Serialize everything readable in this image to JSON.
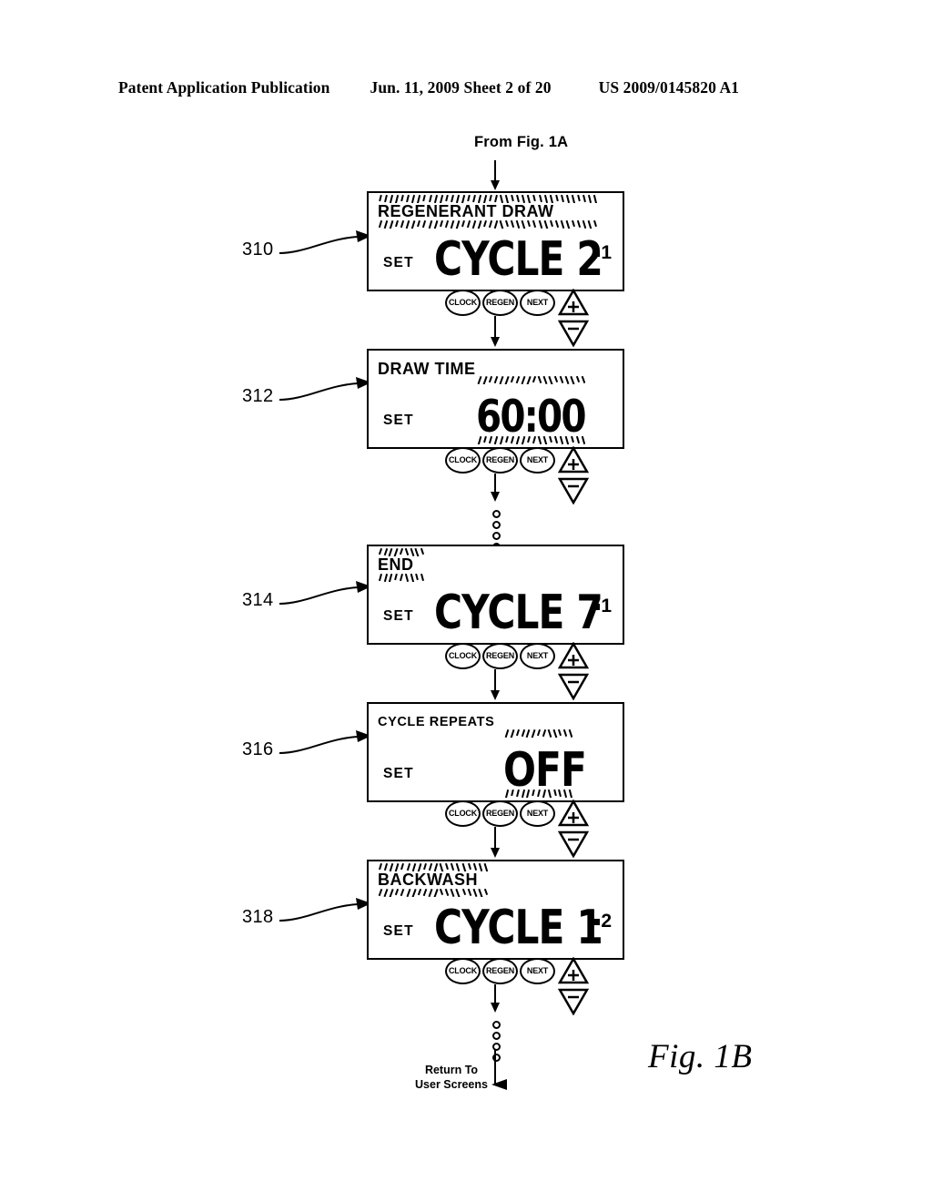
{
  "header": {
    "left": "Patent Application Publication",
    "middle": "Jun. 11, 2009  Sheet 2 of 20",
    "right": "US 2009/0145820 A1"
  },
  "figure": {
    "entry_label": "From Fig. 1A",
    "caption": "Fig. 1B",
    "return_line1": "Return To",
    "return_line2": "User Screens"
  },
  "buttons": {
    "clock": "CLOCK",
    "regen": "REGEN",
    "next": "NEXT",
    "up": "+",
    "down": "−"
  },
  "panels": [
    {
      "ref": "310",
      "title": "REGENERANT DRAW",
      "title_flashing": true,
      "set_label": "SET",
      "value": "CYCLE 2",
      "value_flashing": false,
      "marker_dot": "▪",
      "marker_number": "1"
    },
    {
      "ref": "312",
      "title": "DRAW TIME",
      "title_flashing": false,
      "set_label": "SET",
      "value": "60:00",
      "value_flashing": true,
      "marker_dot": "",
      "marker_number": ""
    },
    {
      "ref": "314",
      "title": "END",
      "title_flashing": true,
      "set_label": "SET",
      "value": "CYCLE 7",
      "value_flashing": false,
      "marker_dot": "▪",
      "marker_number": "1"
    },
    {
      "ref": "316",
      "title": "CYCLE REPEATS",
      "title_flashing": false,
      "set_label": "SET",
      "value": "OFF",
      "value_flashing": true,
      "marker_dot": "",
      "marker_number": ""
    },
    {
      "ref": "318",
      "title": "BACKWASH",
      "title_flashing": true,
      "set_label": "SET",
      "value": "CYCLE 1",
      "value_flashing": false,
      "marker_dot": "▪",
      "marker_number": "2"
    }
  ]
}
